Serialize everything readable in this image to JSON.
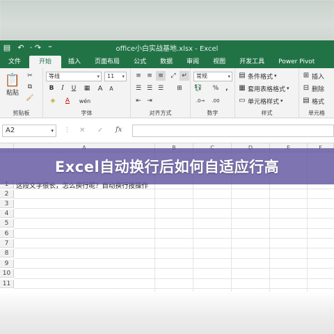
{
  "window": {
    "title": "office小白实战基地.xlsx - Excel"
  },
  "quick_access": {
    "save_icon": "save-icon",
    "undo_icon": "undo-icon",
    "redo_icon": "redo-icon",
    "more": "⁼"
  },
  "tabs": [
    {
      "label": "文件"
    },
    {
      "label": "开始"
    },
    {
      "label": "插入"
    },
    {
      "label": "页面布局"
    },
    {
      "label": "公式"
    },
    {
      "label": "数据"
    },
    {
      "label": "审阅"
    },
    {
      "label": "视图"
    },
    {
      "label": "开发工具"
    },
    {
      "label": "Power Pivot"
    }
  ],
  "ribbon": {
    "clipboard": {
      "paste_label": "粘贴",
      "group_label": "剪贴板"
    },
    "font": {
      "font_name": "等线",
      "font_size": "11",
      "bold": "B",
      "italic": "I",
      "underline": "U",
      "group_label": "字体",
      "grow": "A",
      "shrink": "A",
      "wen": "wén"
    },
    "alignment": {
      "group_label": "对齐方式"
    },
    "number": {
      "format": "常规",
      "percent": "%",
      "comma": ",",
      "group_label": "数字"
    },
    "styles": {
      "conditional": "条件格式",
      "table": "套用表格格式",
      "cell": "单元格样式",
      "group_label": "样式"
    },
    "cells": {
      "insert": "插入",
      "delete": "删除",
      "format": "格式",
      "group_label": "单元格"
    }
  },
  "formula_bar": {
    "name_box": "A2",
    "cancel": "✕",
    "confirm": "✓",
    "fx": "fx"
  },
  "grid": {
    "columns": [
      "A",
      "B",
      "C",
      "D",
      "E",
      "F"
    ],
    "rows": [
      "1",
      "2",
      "3",
      "4",
      "5",
      "6",
      "7",
      "8",
      "9",
      "10",
      "11"
    ],
    "cell_a1": "这段文字很长，怎么换行呢？自动换行按操作"
  },
  "banner": {
    "text": "Excel自动换行后如何自适应行高"
  },
  "colors": {
    "excel_green": "#217346",
    "banner": "#6256a0"
  }
}
